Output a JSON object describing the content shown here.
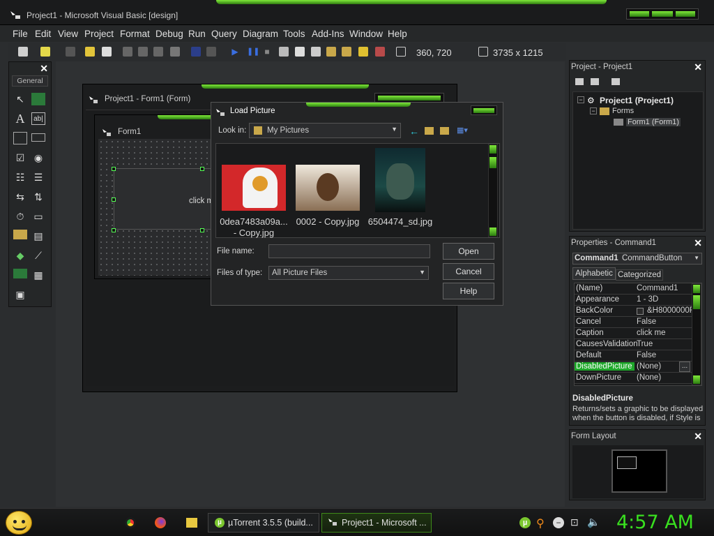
{
  "window": {
    "title": "Project1 - Microsoft Visual Basic [design]"
  },
  "menu": [
    "File",
    "Edit",
    "View",
    "Project",
    "Format",
    "Debug",
    "Run",
    "Query",
    "Diagram",
    "Tools",
    "Add-Ins",
    "Window",
    "Help"
  ],
  "toolbar": {
    "position": "360, 720",
    "size": "3735 x 1215"
  },
  "toolbox": {
    "tab": "General"
  },
  "form_designer": {
    "title": "Project1 - Form1 (Form)",
    "form_caption": "Form1",
    "button_caption": "click m"
  },
  "dialog": {
    "title": "Load Picture",
    "look_in_label": "Look in:",
    "look_in_value": "My Pictures",
    "files": [
      {
        "name_line1": "0dea7483a09a...",
        "name_line2": "- Copy.jpg"
      },
      {
        "name_line1": "0002 - Copy.jpg",
        "name_line2": ""
      },
      {
        "name_line1": "6504474_sd.jpg",
        "name_line2": ""
      }
    ],
    "file_name_label": "File name:",
    "file_name_value": "",
    "files_of_type_label": "Files of type:",
    "files_of_type_value": "All Picture Files",
    "open_label": "Open",
    "cancel_label": "Cancel",
    "help_label": "Help"
  },
  "project_panel": {
    "title": "Project - Project1",
    "tree": {
      "root": "Project1 (Project1)",
      "folder": "Forms",
      "item": "Form1 (Form1)"
    }
  },
  "properties_panel": {
    "title": "Properties - Command1",
    "object": "Command1",
    "object_type": "CommandButton",
    "tabs": [
      "Alphabetic",
      "Categorized"
    ],
    "rows": [
      {
        "k": "(Name)",
        "v": "Command1"
      },
      {
        "k": "Appearance",
        "v": "1 - 3D"
      },
      {
        "k": "BackColor",
        "v": "&H8000000F"
      },
      {
        "k": "Cancel",
        "v": "False"
      },
      {
        "k": "Caption",
        "v": "click me"
      },
      {
        "k": "CausesValidation",
        "v": "True"
      },
      {
        "k": "Default",
        "v": "False"
      },
      {
        "k": "DisabledPicture",
        "v": "(None)"
      },
      {
        "k": "DownPicture",
        "v": "(None)"
      }
    ],
    "desc_title": "DisabledPicture",
    "desc_text": "Returns/sets a graphic to be displayed when the button is disabled, if Style is"
  },
  "form_layout": {
    "title": "Form Layout"
  },
  "taskbar": {
    "tasks": [
      "µTorrent 3.5.5  (build...",
      "Project1 - Microsoft ..."
    ],
    "clock": "4:57 AM"
  },
  "colors": {
    "accent": "#5fd41e",
    "selected": "#1fa82b"
  }
}
